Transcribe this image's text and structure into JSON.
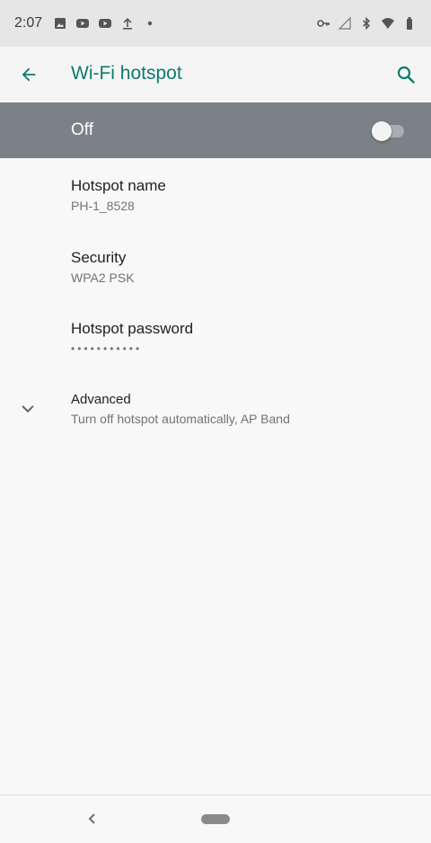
{
  "status_bar": {
    "time": "2:07",
    "left_icons": [
      "image-icon",
      "youtube-icon",
      "youtube-icon",
      "upload-icon",
      "dot-icon"
    ],
    "right_icons": [
      "vpn-key-icon",
      "cell-signal-icon",
      "bluetooth-icon",
      "wifi-icon",
      "battery-icon"
    ]
  },
  "app_bar": {
    "title": "Wi-Fi hotspot",
    "back_icon": "arrow-left-icon",
    "search_icon": "search-icon",
    "accent_color": "#0f7a6c"
  },
  "master_switch": {
    "label": "Off",
    "state": "off",
    "bar_color": "#7c8188"
  },
  "preferences": [
    {
      "title": "Hotspot name",
      "summary": "PH-1_8528"
    },
    {
      "title": "Security",
      "summary": "WPA2 PSK"
    },
    {
      "title": "Hotspot password",
      "summary": "•••••••••••"
    }
  ],
  "advanced": {
    "title": "Advanced",
    "summary": "Turn off hotspot automatically, AP Band",
    "icon": "chevron-down-icon"
  },
  "nav_bar": {
    "back_icon": "nav-back-icon",
    "home_icon": "home-pill-icon"
  }
}
